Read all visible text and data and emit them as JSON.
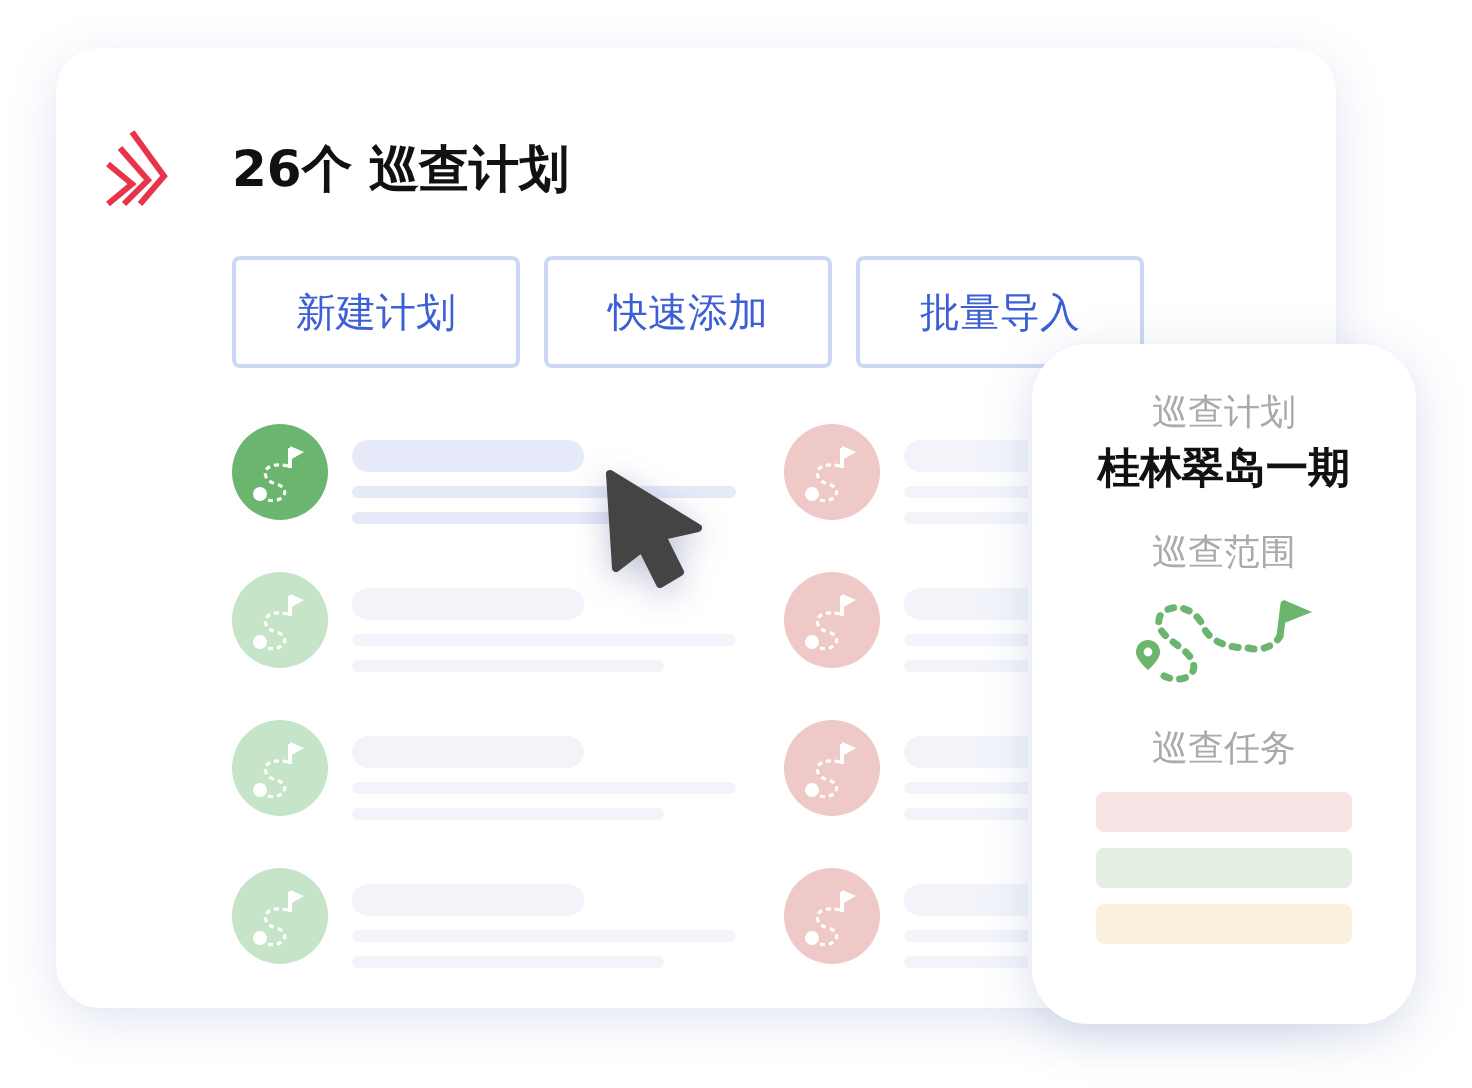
{
  "header": {
    "count_title": "26个 巡查计划"
  },
  "actions": [
    "新建计划",
    "快速添加",
    "批量导入"
  ],
  "plans": [
    {
      "color": "#6bb56f",
      "selected": true
    },
    {
      "color": "#efc8c8",
      "selected": false
    },
    {
      "color": "#c6e4c7",
      "selected": false
    },
    {
      "color": "#efc8c8",
      "selected": false
    },
    {
      "color": "#c6e4c7",
      "selected": false
    },
    {
      "color": "#efc8c8",
      "selected": false
    },
    {
      "color": "#c6e4c7",
      "selected": false
    },
    {
      "color": "#efc8c8",
      "selected": false
    }
  ],
  "detail": {
    "plan_label": "巡查计划",
    "plan_name": "桂林翠岛一期",
    "range_label": "巡查范围",
    "tasks_label": "巡查任务",
    "tasks": [
      {
        "color": "#f7e4e4"
      },
      {
        "color": "#e3f0e3"
      },
      {
        "color": "#faf0dc"
      }
    ]
  }
}
